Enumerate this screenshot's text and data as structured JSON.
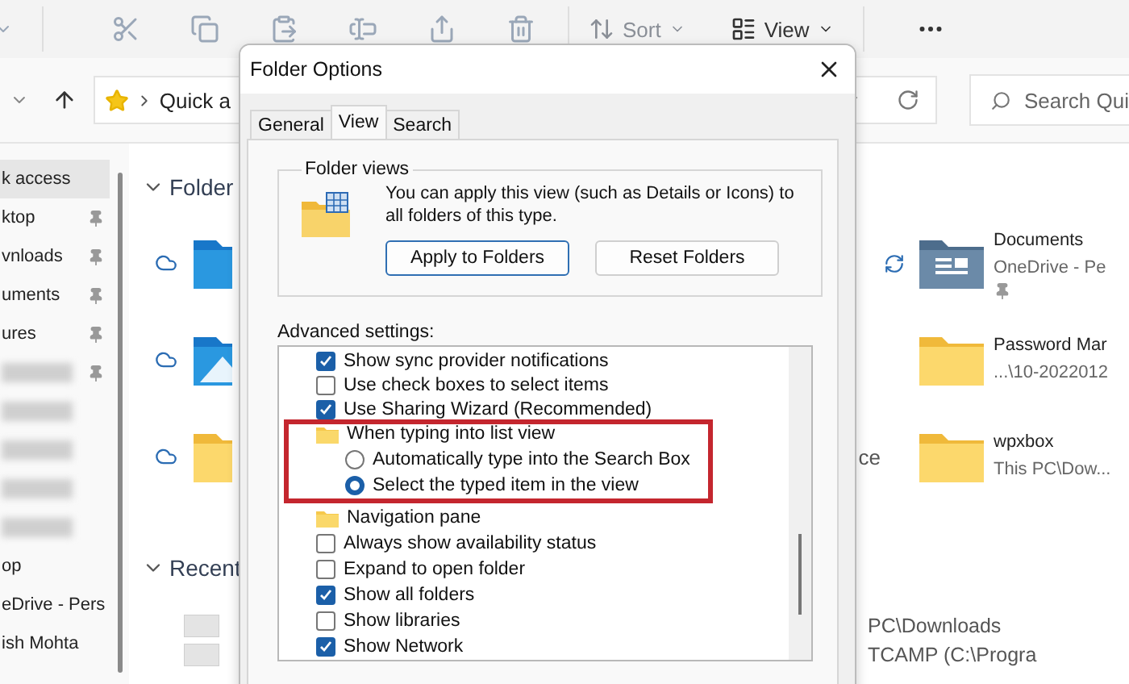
{
  "explorer": {
    "toolbar": {
      "sort": "Sort",
      "view": "View"
    },
    "address": {
      "path": "Quick a"
    },
    "search": {
      "placeholder": "Search Qui"
    },
    "sidebar": {
      "items": [
        {
          "kind": "entry",
          "label": "k access",
          "selected": true,
          "pinned": false
        },
        {
          "kind": "entry",
          "label": "ktop",
          "selected": false,
          "pinned": true
        },
        {
          "kind": "entry",
          "label": "vnloads",
          "selected": false,
          "pinned": true
        },
        {
          "kind": "entry",
          "label": "uments",
          "selected": false,
          "pinned": true
        },
        {
          "kind": "entry",
          "label": "ures",
          "selected": false,
          "pinned": true
        },
        {
          "kind": "blurred",
          "selected": false,
          "pinned": true
        },
        {
          "kind": "blurred",
          "selected": false,
          "pinned": false
        },
        {
          "kind": "blurred",
          "selected": false,
          "pinned": false
        },
        {
          "kind": "blurred",
          "selected": false,
          "pinned": false
        },
        {
          "kind": "blurred",
          "selected": false,
          "pinned": false
        },
        {
          "kind": "entry",
          "label": "op",
          "selected": false,
          "pinned": false
        },
        {
          "kind": "entry",
          "label": "eDrive - Pers",
          "selected": false,
          "pinned": false
        },
        {
          "kind": "entry",
          "label": "ish Mohta",
          "selected": false,
          "pinned": false
        }
      ]
    },
    "folders_title": "Folder",
    "folders": [
      {
        "left": {
          "kind": "blue"
        },
        "right": {
          "name": "Documents",
          "location": "OneDrive - Pe",
          "kind": "documents",
          "pinned": true
        }
      },
      {
        "left": {
          "kind": "pictures"
        },
        "right": {
          "name": "Password Mar",
          "location": "...\\10-2022012",
          "kind": "folder",
          "pinned": false
        }
      },
      {
        "left": {
          "kind": "folder",
          "tail": "ce"
        },
        "right": {
          "name": "wpxbox",
          "location": "This PC\\Dow...",
          "kind": "folder",
          "pinned": false
        }
      }
    ],
    "recent_title": "Recent",
    "recent": [
      {
        "location": "PC\\Downloads"
      },
      {
        "location": "TCAMP (C:\\Progra"
      }
    ]
  },
  "dialog": {
    "title": "Folder Options",
    "tabs": [
      {
        "label": "General",
        "selected": false
      },
      {
        "label": "View",
        "selected": true
      },
      {
        "label": "Search",
        "selected": false
      }
    ],
    "folder_views": {
      "title": "Folder views",
      "text": "You can apply this view (such as Details or Icons) to all folders of this type.",
      "buttons": [
        "Apply to Folders",
        "Reset Folders"
      ]
    },
    "advanced_label": "Advanced settings:",
    "settings": [
      {
        "kind": "checkbox",
        "label": "Show sync provider notifications",
        "checked": true
      },
      {
        "kind": "checkbox",
        "label": "Use check boxes to select items",
        "checked": false
      },
      {
        "kind": "checkbox",
        "label": "Use Sharing Wizard (Recommended)",
        "checked": true
      },
      {
        "kind": "group",
        "label": "When typing into list view",
        "highlighted": true,
        "children": [
          {
            "kind": "radio",
            "label": "Automatically type into the Search Box",
            "selected": false
          },
          {
            "kind": "radio",
            "label": "Select the typed item in the view",
            "selected": true
          }
        ]
      },
      {
        "kind": "category",
        "label": "Navigation pane",
        "highlighted": false,
        "children": [
          {
            "kind": "checkbox",
            "label": "Always show availability status",
            "checked": false
          },
          {
            "kind": "checkbox",
            "label": "Expand to open folder",
            "checked": false
          },
          {
            "kind": "checkbox",
            "label": "Show all folders",
            "checked": true
          },
          {
            "kind": "checkbox",
            "label": "Show libraries",
            "checked": false
          },
          {
            "kind": "checkbox",
            "label": "Show Network",
            "checked": true
          }
        ]
      }
    ]
  }
}
